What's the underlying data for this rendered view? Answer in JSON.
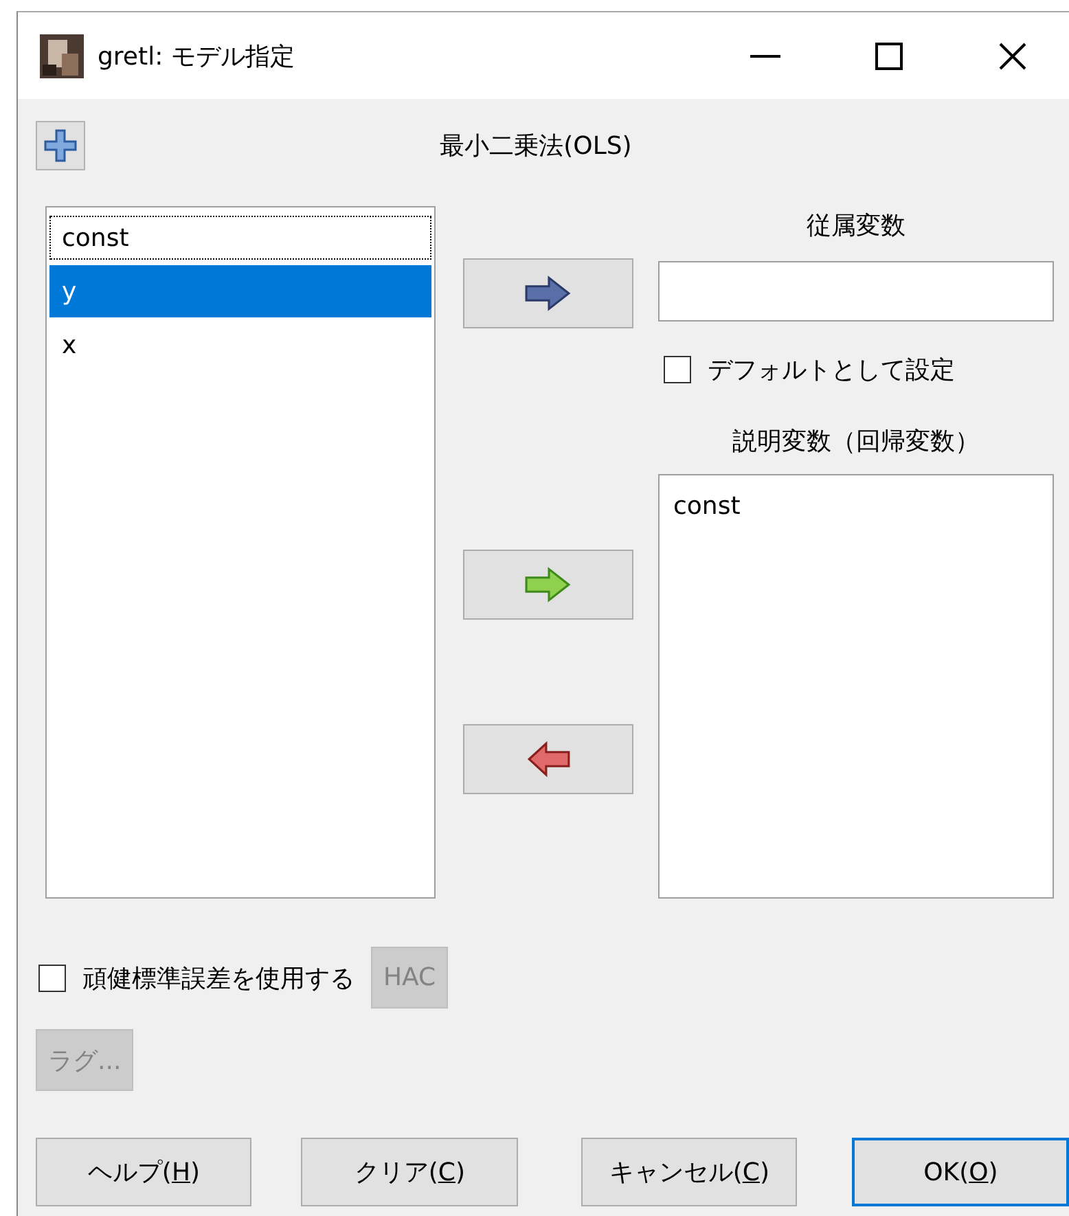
{
  "window": {
    "title": "gretl: モデル指定"
  },
  "heading": "最小二乗法(OLS)",
  "variables": [
    {
      "label": "const",
      "selected": false,
      "focused": true
    },
    {
      "label": "y",
      "selected": true,
      "focused": false
    },
    {
      "label": "x",
      "selected": false,
      "focused": false
    }
  ],
  "dependent": {
    "label": "従属変数"
  },
  "default_checkbox": {
    "label": "デフォルトとして設定",
    "checked": false
  },
  "regressors": {
    "label": "説明変数（回帰変数）",
    "items": [
      "const"
    ]
  },
  "robust_checkbox": {
    "label": "頑健標準誤差を使用する",
    "checked": false
  },
  "hac_button": {
    "label": "HAC",
    "disabled": true
  },
  "lag_button": {
    "label": "ラグ...",
    "disabled": true
  },
  "buttons": [
    {
      "before": "ヘルプ(",
      "mnemonic": "H",
      "after": ")",
      "default": false
    },
    {
      "before": "クリア(",
      "mnemonic": "C",
      "after": ")",
      "default": false
    },
    {
      "before": "キャンセル(",
      "mnemonic": "C",
      "after": ")",
      "default": false
    },
    {
      "before": "OK(",
      "mnemonic": "O",
      "after": ")",
      "default": true
    }
  ]
}
